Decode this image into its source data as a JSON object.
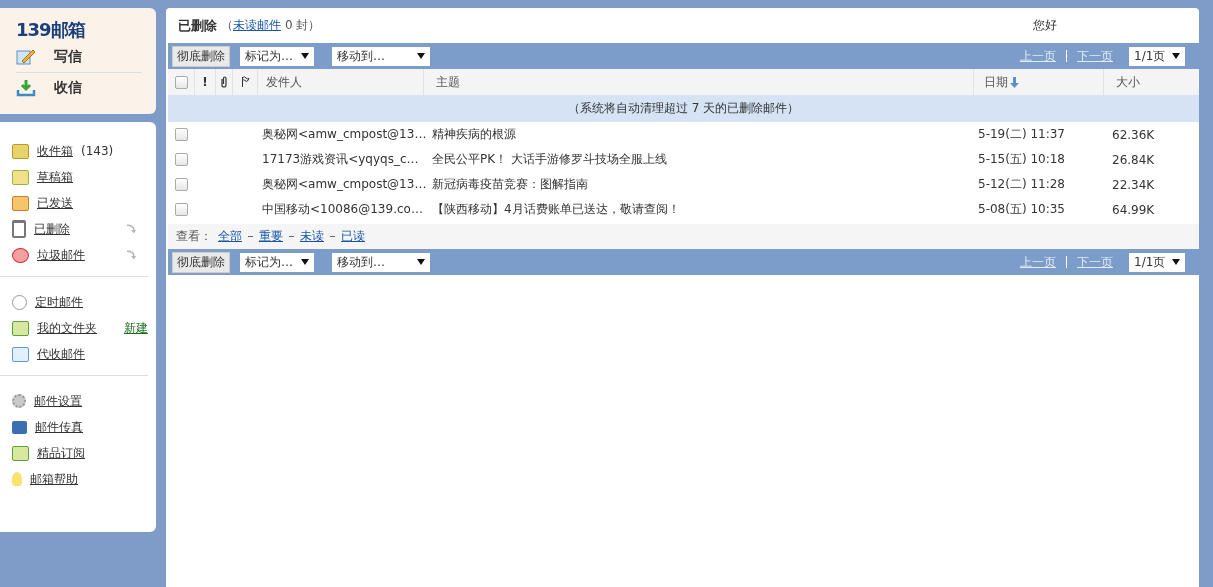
{
  "logo": "139邮箱",
  "compose": [
    {
      "label": "写信"
    },
    {
      "label": "收信"
    }
  ],
  "folder_groups": [
    {
      "items": [
        {
          "label": "收件箱",
          "count": "(143)",
          "menu_arrow": false
        },
        {
          "label": "草稿箱",
          "menu_arrow": false
        },
        {
          "label": "已发送",
          "menu_arrow": false
        },
        {
          "label": "已删除",
          "menu_arrow": true
        },
        {
          "label": "垃圾邮件",
          "menu_arrow": true
        }
      ]
    },
    {
      "items": [
        {
          "label": "定时邮件",
          "menu_arrow": false
        },
        {
          "label": "我的文件夹",
          "action": "新建",
          "menu_arrow": false
        },
        {
          "label": "代收邮件",
          "menu_arrow": false
        }
      ]
    },
    {
      "items": [
        {
          "label": "邮件设置",
          "menu_arrow": false
        },
        {
          "label": "邮件传真",
          "menu_arrow": false
        },
        {
          "label": "精品订阅",
          "menu_arrow": false
        },
        {
          "label": "邮箱帮助",
          "menu_arrow": false
        }
      ]
    }
  ],
  "header": {
    "title": "已删除",
    "open": "（",
    "unread_link": "未读邮件",
    "unread_count": "0 封）",
    "greeting": "您好"
  },
  "toolbars": [
    {
      "button": "彻底删除",
      "dropdowns": [
        "标记为…",
        "移动到…"
      ],
      "prev": "上一页",
      "next": "下一页",
      "pager_disabled": true,
      "page": "1/1页"
    },
    {
      "button": "彻底删除",
      "dropdowns": [
        "标记为…",
        "移动到…"
      ],
      "prev": "上一页",
      "next": "下一页",
      "pager_disabled": true,
      "page": "1/1页"
    }
  ],
  "columns": {
    "select_all_checked": false,
    "important": "!",
    "sender": "发件人",
    "subject": "主题",
    "date": "日期",
    "size": "大小"
  },
  "notice": "（系统将自动清理超过 7 天的已删除邮件）",
  "rows": [
    {
      "checked": false,
      "sender": "奥秘网<amw_cmpost@13…",
      "subject": "精神疾病的根源",
      "date": "5-19(二) 11:37",
      "size": "62.36K"
    },
    {
      "checked": false,
      "sender": "17173游戏资讯<yqyqs_c…",
      "subject": "全民公平PK！ 大话手游修罗斗技场全服上线",
      "date": "5-15(五) 10:18",
      "size": "26.84K"
    },
    {
      "checked": false,
      "sender": "奥秘网<amw_cmpost@13…",
      "subject": "新冠病毒疫苗竞赛：图解指南",
      "date": "5-12(二) 11:28",
      "size": "22.34K"
    },
    {
      "checked": false,
      "sender": "中国移动<10086@139.co…",
      "subject": "【陕西移动】4月话费账单已送达，敬请查阅！",
      "date": "5-08(五) 10:35",
      "size": "64.99K"
    }
  ],
  "view_filter": {
    "label": "查看：",
    "links": [
      "全部",
      "重要",
      "未读",
      "已读"
    ]
  }
}
